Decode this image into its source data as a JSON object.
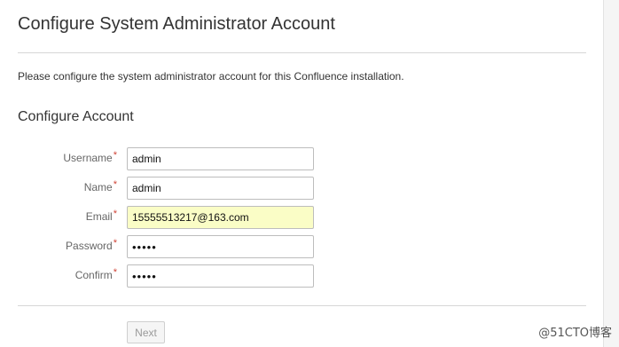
{
  "header": {
    "title": "Configure System Administrator Account"
  },
  "intro_text": "Please configure the system administrator account for this Confluence installation.",
  "section_title": "Configure Account",
  "required_marker": "*",
  "fields": [
    {
      "label": "Username",
      "value": "admin"
    },
    {
      "label": "Name",
      "value": "admin"
    },
    {
      "label": "Email",
      "value": "15555513217@163.com"
    },
    {
      "label": "Password",
      "value": "•••••"
    },
    {
      "label": "Confirm",
      "value": "•••••"
    }
  ],
  "buttons": {
    "next_label": "Next"
  },
  "watermark": "@51CTO博客",
  "colors": {
    "required": "#d04437",
    "autofill_bg": "#fafdc6"
  }
}
